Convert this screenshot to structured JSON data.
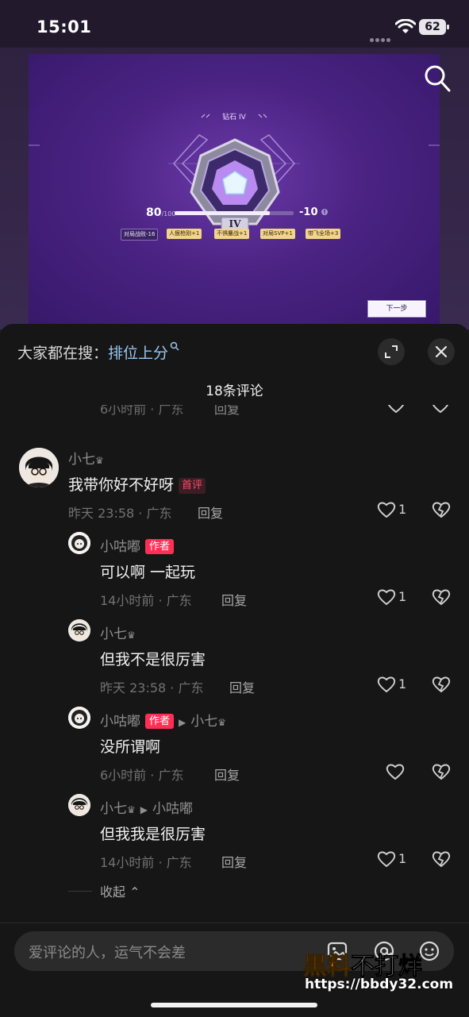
{
  "status": {
    "time": "15:01",
    "battery": "62"
  },
  "video": {
    "rank_title": "钻石 IV",
    "rank_numeral": "IV",
    "points": "80",
    "points_max": "/100",
    "points_progress": 0.8,
    "delta": "-10",
    "chips": [
      "对局战败-16",
      "人狠枪刚+1",
      "不惧鏖战+1",
      "对局SVP+1",
      "带飞全场+3"
    ],
    "next_label": "下一步"
  },
  "sheet": {
    "hot_search_prefix": "大家都在搜：",
    "hot_search_term": "排位上分",
    "comment_count_title": "18条评论",
    "cutoff_meta": "6小时前 · 广东",
    "cutoff_reply": "回复"
  },
  "comments": [
    {
      "user": "小七",
      "crown": "♛",
      "badge_first": "首评",
      "text": "我带你好不好呀",
      "meta": "昨天 23:58 · 广东",
      "reply": "回复",
      "likes": "1"
    },
    {
      "user": "小咕嘟",
      "badge_author": "作者",
      "text": "可以啊 一起玩",
      "meta": "14小时前 · 广东",
      "reply": "回复",
      "likes": "1"
    },
    {
      "user": "小七",
      "crown": "♛",
      "text": "但我不是很厉害",
      "meta": "昨天 23:58 · 广东",
      "reply": "回复",
      "likes": "1"
    },
    {
      "user": "小咕嘟",
      "badge_author": "作者",
      "reply_to": "小七",
      "text": "没所谓啊",
      "meta": "6小时前 · 广东",
      "reply": "回复",
      "likes": ""
    },
    {
      "user": "小七",
      "crown": "♛",
      "reply_to": "小咕嘟",
      "text": "但我我是很厉害",
      "meta": "14小时前 · 广东",
      "reply": "回复",
      "likes": "1"
    }
  ],
  "collapse_label": "收起",
  "input": {
    "placeholder": "爱评论的人，运气不会差"
  },
  "watermark": {
    "brand_a": "黑料",
    "brand_b": "不打烊",
    "url": "https://bbdy32.com"
  },
  "icons": {
    "search": "magnifier-icon",
    "expand": "expand-icon",
    "close": "close-icon",
    "like": "heart-icon",
    "dislike": "broken-heart-icon",
    "image": "image-icon",
    "at": "at-icon",
    "emoji": "emoji-icon"
  },
  "colors": {
    "author_badge": "#ff2e55",
    "hot_link": "#9cc6f2",
    "game_purple": "#4b2383"
  }
}
